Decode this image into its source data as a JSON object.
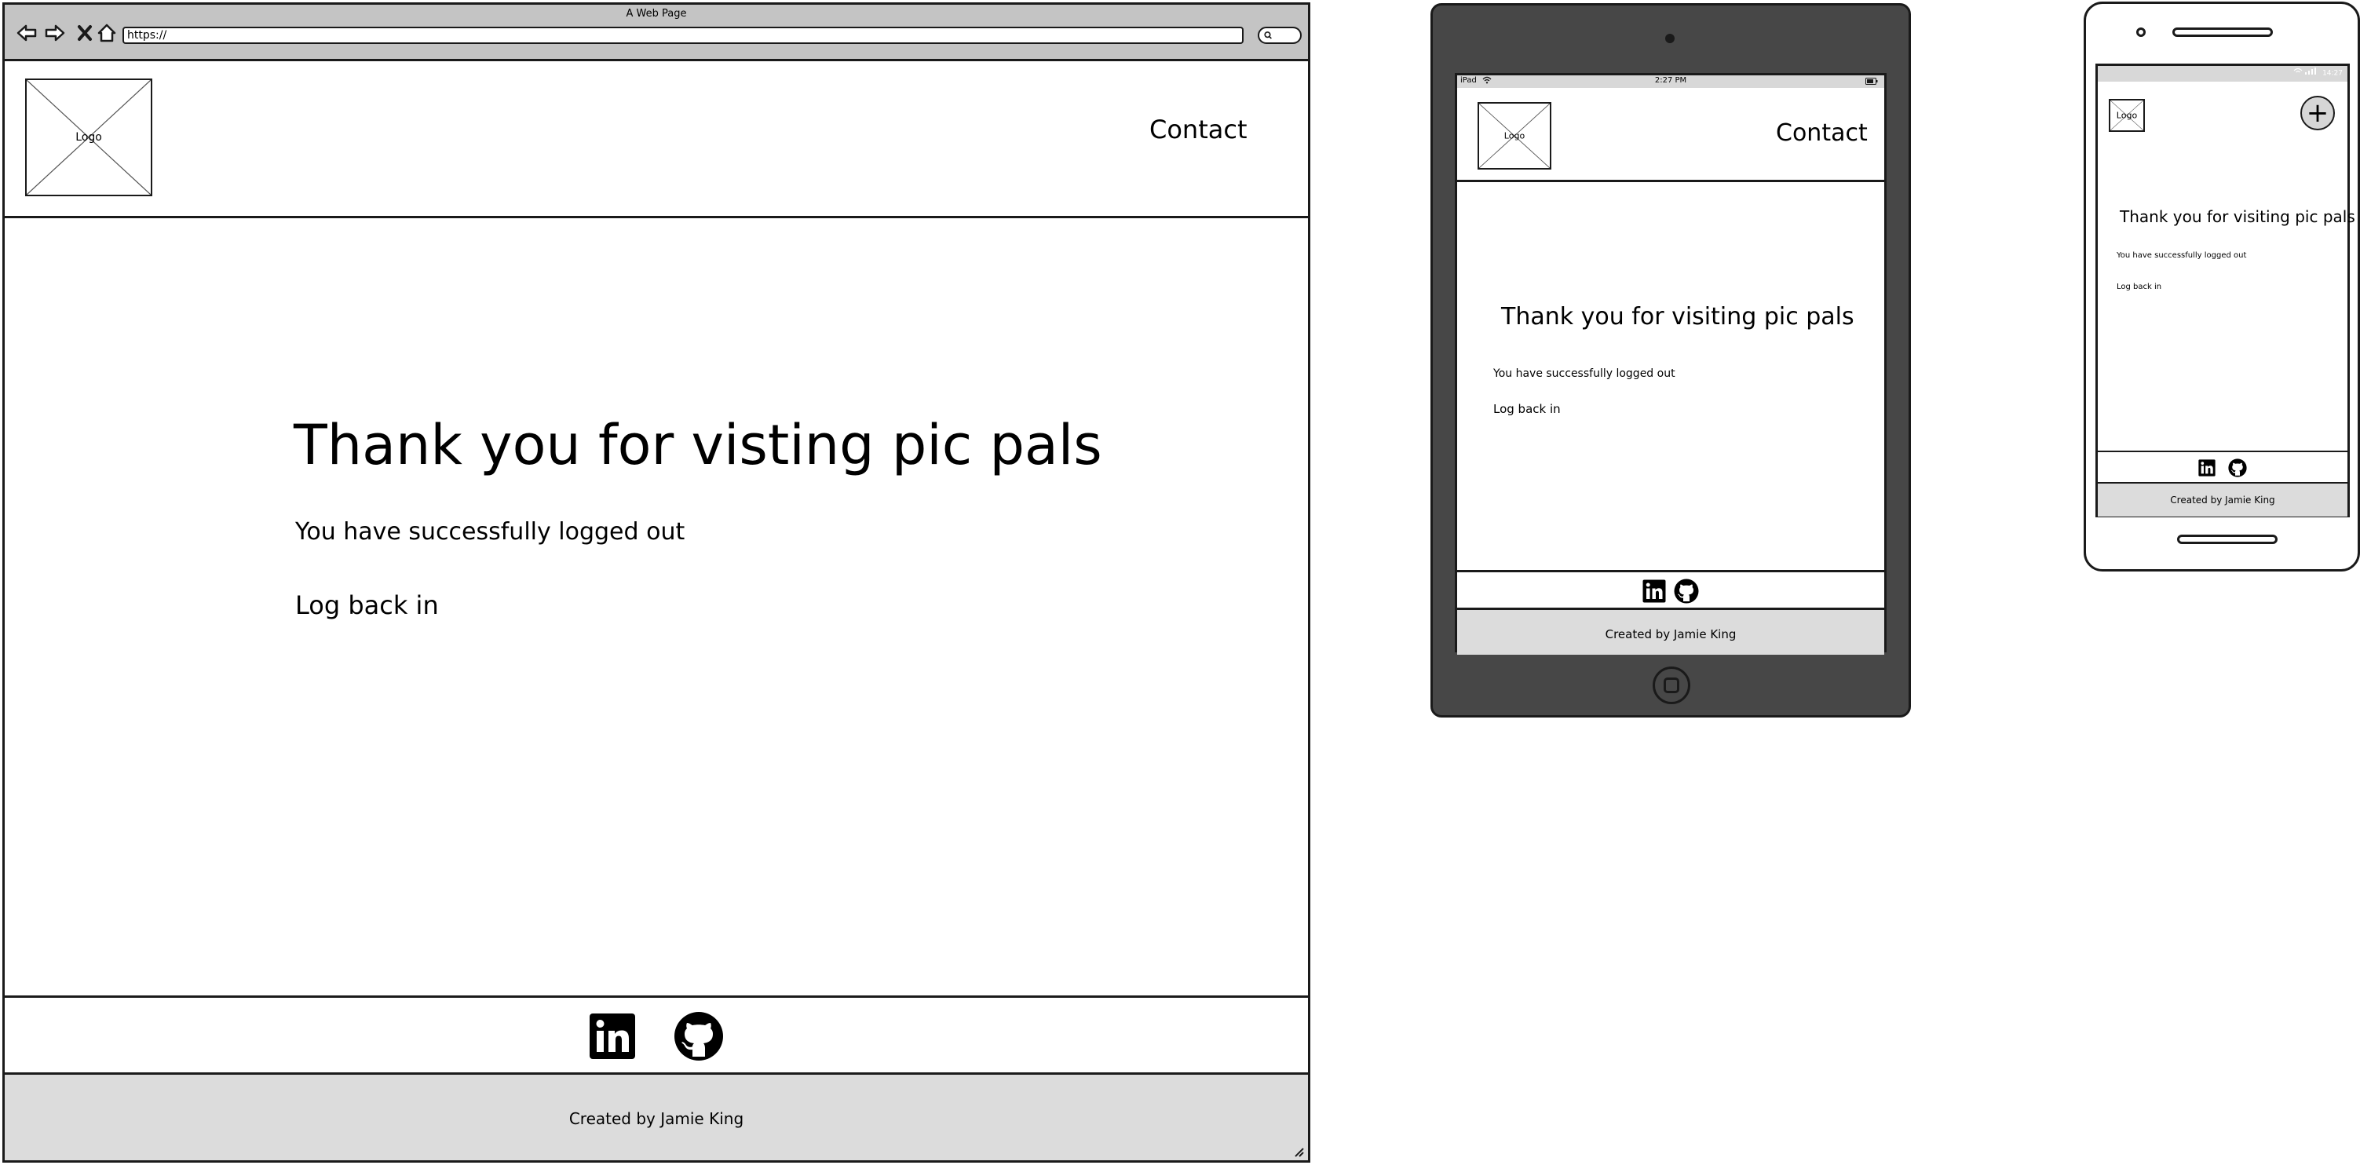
{
  "desktop": {
    "browser": {
      "title": "A Web Page",
      "url": "https://"
    },
    "header": {
      "logo_label": "Logo",
      "contact_label": "Contact"
    },
    "main": {
      "title": "Thank you for visting pic pals",
      "logout_message": "You have successfully logged out",
      "login_link": "Log back in"
    },
    "footer": {
      "credit": "Created by Jamie King"
    }
  },
  "tablet": {
    "status": {
      "device": "iPad",
      "time": "2:27 PM"
    },
    "header": {
      "logo_label": "Logo",
      "contact_label": "Contact"
    },
    "main": {
      "title": "Thank you for visiting pic pals",
      "logout_message": "You have successfully logged out",
      "login_link": "Log back in"
    },
    "footer": {
      "credit": "Created by Jamie King"
    }
  },
  "phone": {
    "status": {
      "time": "14:27"
    },
    "header": {
      "logo_label": "Logo",
      "add_label": "+"
    },
    "main": {
      "title": "Thank you for visiting pic pals",
      "logout_message": "You have successfully logged out",
      "login_link": "Log back in"
    },
    "footer": {
      "credit": "Created by Jamie King"
    }
  },
  "icons": {
    "social": [
      "linkedin-icon",
      "github-icon"
    ]
  },
  "colors": {
    "frame_dark": "#474747",
    "footer_gray": "#dcdcdc",
    "chrome_gray": "#c4c4c4"
  }
}
